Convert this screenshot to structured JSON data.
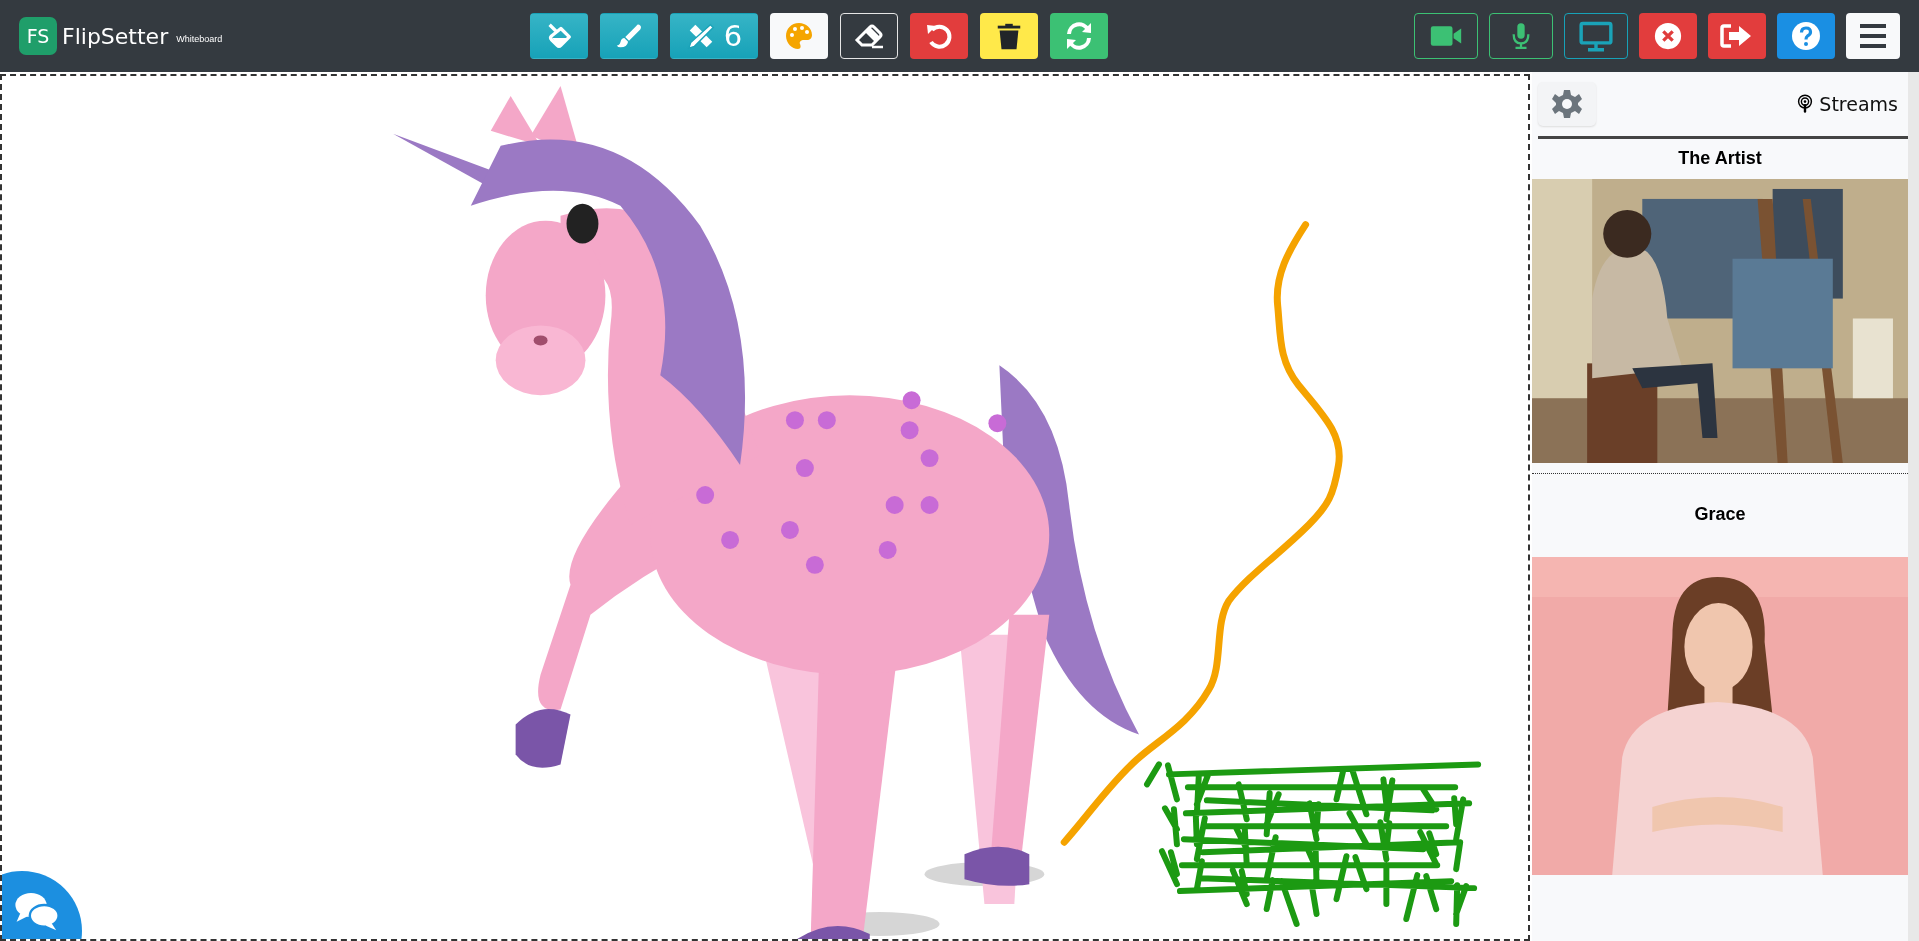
{
  "app": {
    "logo_mark": "FS",
    "name": "FlipSetter",
    "subtitle": "Whiteboard"
  },
  "tools": [
    {
      "kind": "fill"
    },
    {
      "kind": "brush"
    },
    {
      "kind": "shapes",
      "label": "6"
    },
    {
      "kind": "palette"
    },
    {
      "kind": "eraser"
    },
    {
      "kind": "undo"
    },
    {
      "kind": "clear"
    },
    {
      "kind": "refresh"
    }
  ],
  "session_buttons": [
    {
      "kind": "camera"
    },
    {
      "kind": "microphone"
    },
    {
      "kind": "screen"
    },
    {
      "kind": "close"
    },
    {
      "kind": "exit"
    },
    {
      "kind": "help"
    },
    {
      "kind": "menu"
    }
  ],
  "sidebar": {
    "streams_button": "Streams",
    "streams": [
      {
        "name": "The Artist",
        "kind": "picture"
      },
      {
        "name": "Grace",
        "kind": "picture"
      }
    ]
  }
}
